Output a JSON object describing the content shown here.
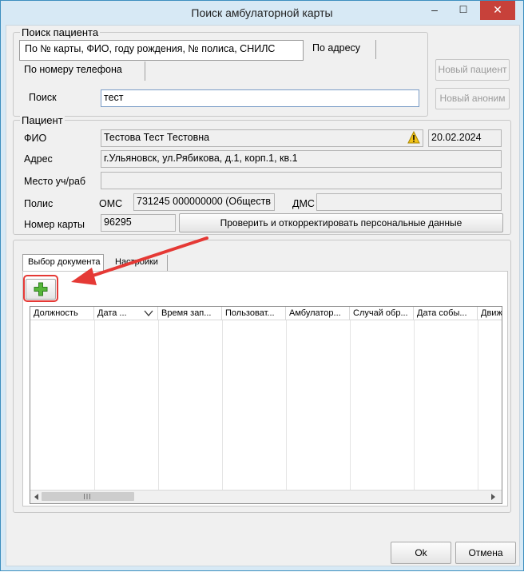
{
  "window": {
    "title": "Поиск амбулаторной карты",
    "minimize_icon": "minimize-icon",
    "maximize_icon": "maximize-icon",
    "close_icon": "close-icon",
    "min_glyph": "–",
    "max_glyph": "☐",
    "close_glyph": "✕"
  },
  "search": {
    "group_title": "Поиск пациента",
    "tabs": [
      "По № карты, ФИО, году рождения, № полиса, СНИЛС",
      "По адресу",
      "По номеру телефона"
    ],
    "label": "Поиск",
    "value": "тест",
    "new_patient_button": "Новый пациент",
    "new_anonymous_button": "Новый аноним"
  },
  "patient": {
    "group_title": "Пациент",
    "fio_label": "ФИО",
    "fio_value": "Тестова Тест Тестовна",
    "warning_icon": "warning-icon",
    "birth_date": "20.02.2024",
    "address_label": "Адрес",
    "address_value": "г.Ульяновск, ул.Рябикова, д.1, корп.1, кв.1",
    "workplace_label": "Место уч/раб",
    "workplace_value": "",
    "policy_label": "Полис",
    "oms_label": "ОМС",
    "oms_value": "731245 000000000 (Обществ",
    "dms_label": "ДМС",
    "dms_value": "",
    "card_label": "Номер карты",
    "card_value": "96295",
    "verify_button": "Проверить и откорректировать персональные данные"
  },
  "documents": {
    "tabs": [
      "Выбор документа",
      "Настройки"
    ],
    "add_icon": "plus-icon",
    "columns": [
      "Должность",
      "Дата ...",
      "Время зап...",
      "Пользоват...",
      "Амбулатор...",
      "Случай обр...",
      "Дата собы...",
      "Движ"
    ],
    "sort_icon": "sort-down-icon",
    "rows": [],
    "scroll_left_icon": "arrow-left-icon",
    "scroll_right_icon": "arrow-right-icon"
  },
  "footer": {
    "ok_button": "Ok",
    "cancel_button": "Отмена"
  },
  "annotation": {
    "color": "#e53935"
  }
}
